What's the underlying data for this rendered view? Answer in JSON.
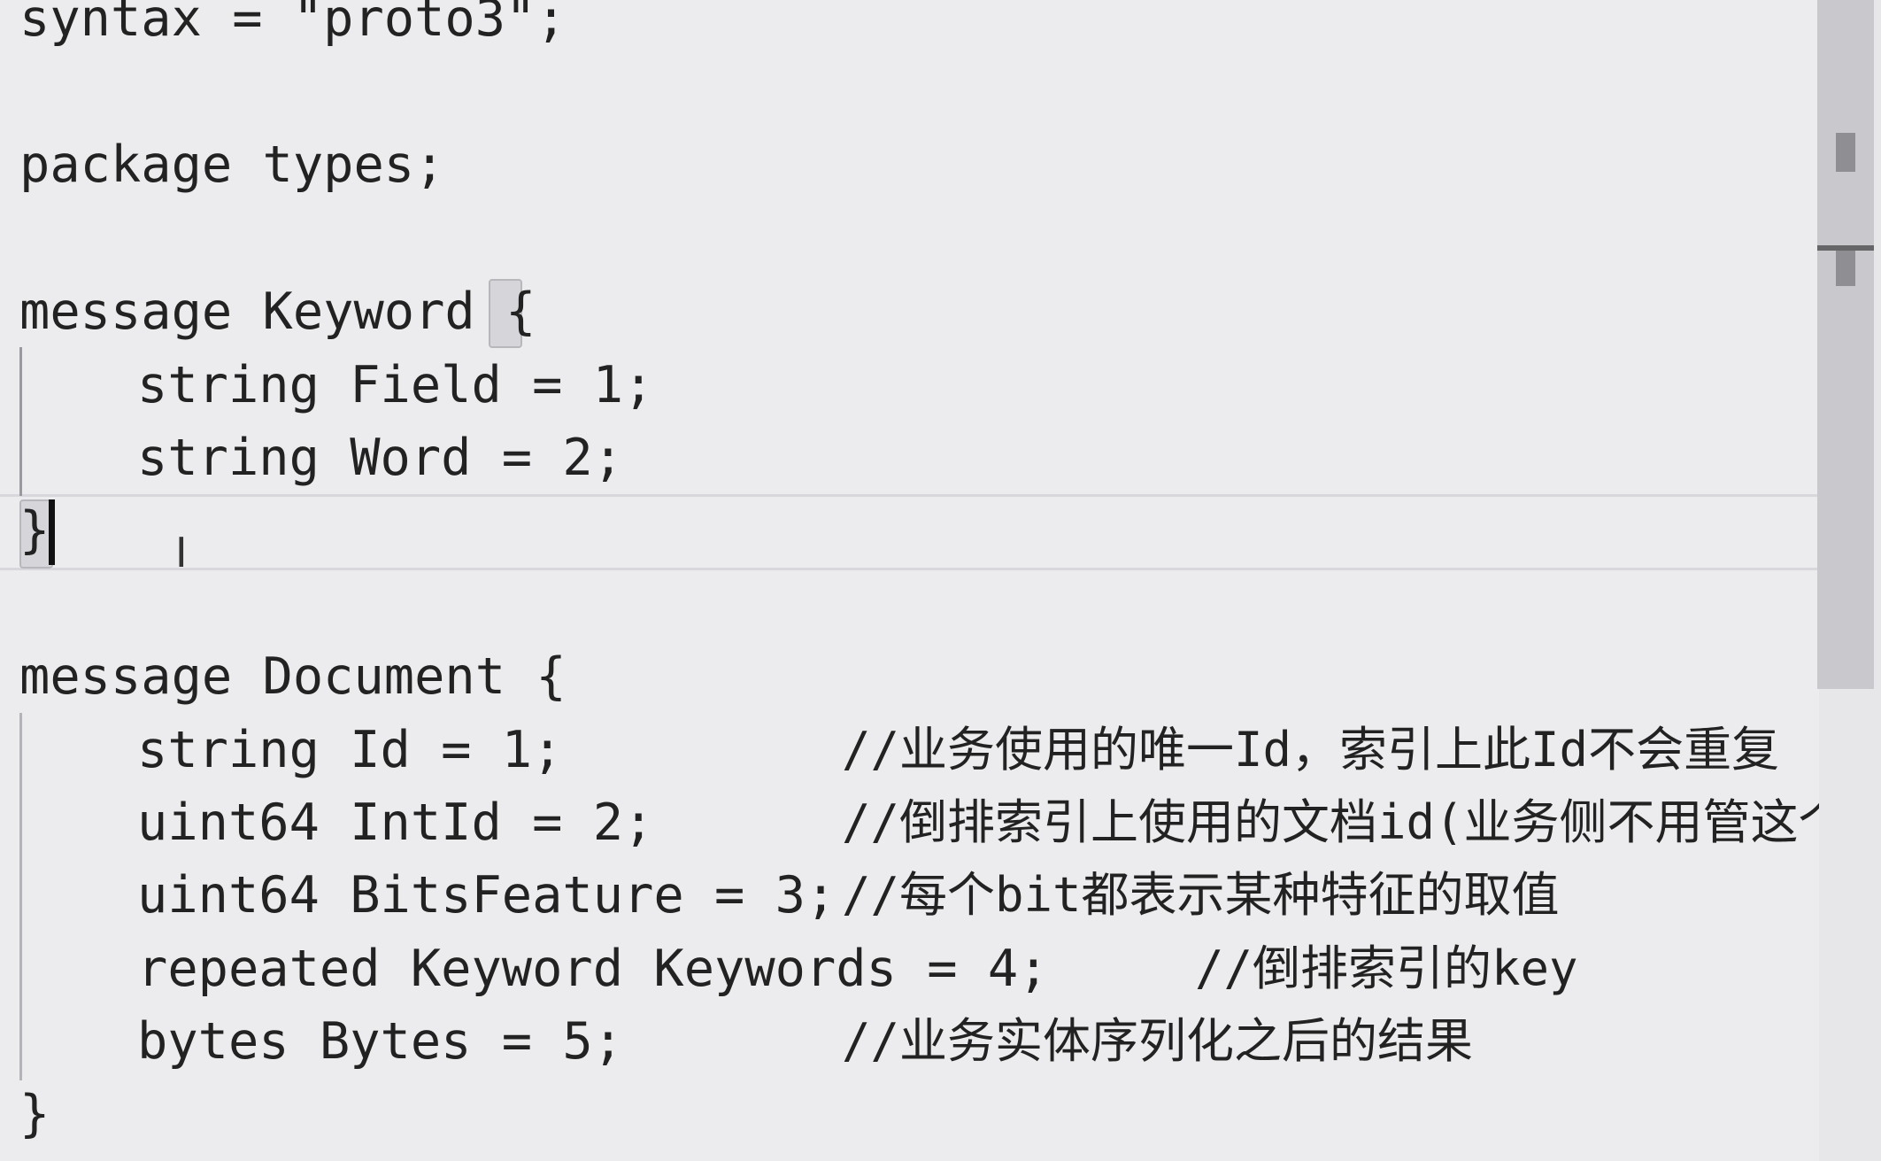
{
  "editor": {
    "lines": [
      "syntax = \"proto3\";",
      "package types;",
      "message Keyword ",
      "{",
      "string Field = 1;",
      "string Word = 2;",
      "}",
      "message Document {",
      "string Id = 1;",
      "uint64 IntId = 2;",
      "uint64 BitsFeature = 3;",
      "repeated Keyword Keywords = 4;",
      "bytes Bytes = 5;",
      "}"
    ],
    "comments": [
      "//业务使用的唯一Id，索引上此Id不会重复",
      "//倒排索引上使用的文档id(业务侧不用管这个",
      "//每个bit都表示某种特征的取值",
      "//倒排索引的key",
      "//业务实体序列化之后的结果"
    ]
  },
  "colors": {
    "background": "#ececee",
    "text": "#222222",
    "scrollbar_thumb": "#c9c9cd"
  }
}
